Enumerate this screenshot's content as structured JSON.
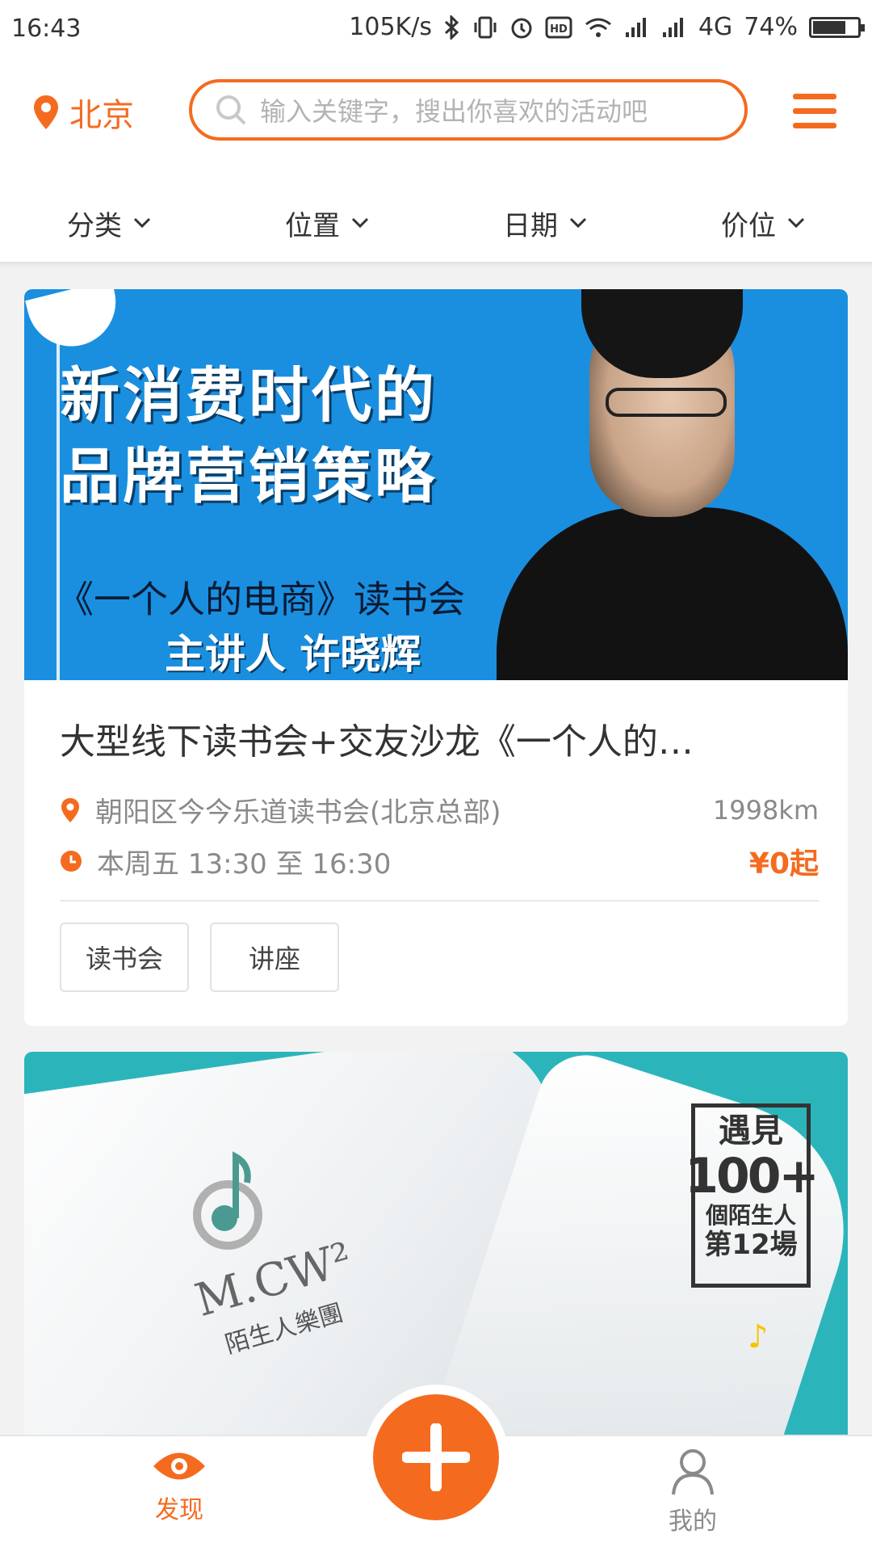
{
  "status_bar": {
    "time": "16:43",
    "speed": "105K/s",
    "network": "4G",
    "battery": "74%",
    "battery_level": 0.74
  },
  "header": {
    "city": "北京",
    "search_placeholder": "输入关键字，搜出你喜欢的活动吧",
    "filters": [
      "分类",
      "位置",
      "日期",
      "价位"
    ]
  },
  "events": [
    {
      "banner": {
        "title_line1": "新消费时代的",
        "title_line2": "品牌营销策略",
        "subtitle": "《一个人的电商》读书会",
        "speaker": "主讲人 许晓辉"
      },
      "title": "大型线下读书会+交友沙龙《一个人的…",
      "location": "朝阳区今今乐道读书会(北京总部)",
      "distance": "1998km",
      "time": "本周五 13:30 至 16:30",
      "price": "¥0起",
      "tags": [
        "读书会",
        "讲座"
      ]
    },
    {
      "banner": {
        "logo_text": "M.CW²",
        "logo_sub": "陌生人樂團",
        "meet_1": "遇見",
        "meet_2": "100+",
        "meet_3": "個陌生人",
        "meet_4": "第12場"
      }
    }
  ],
  "bottom_nav": {
    "discover": "发现",
    "mine": "我的"
  },
  "colors": {
    "accent": "#f46b1f",
    "banner1_bg": "#1a8fe0",
    "banner2_bg": "#2bb5bb"
  },
  "icons": [
    "location-pin-icon",
    "search-icon",
    "menu-icon",
    "chevron-down-icon",
    "clock-icon",
    "eye-icon",
    "plus-icon",
    "user-icon"
  ]
}
